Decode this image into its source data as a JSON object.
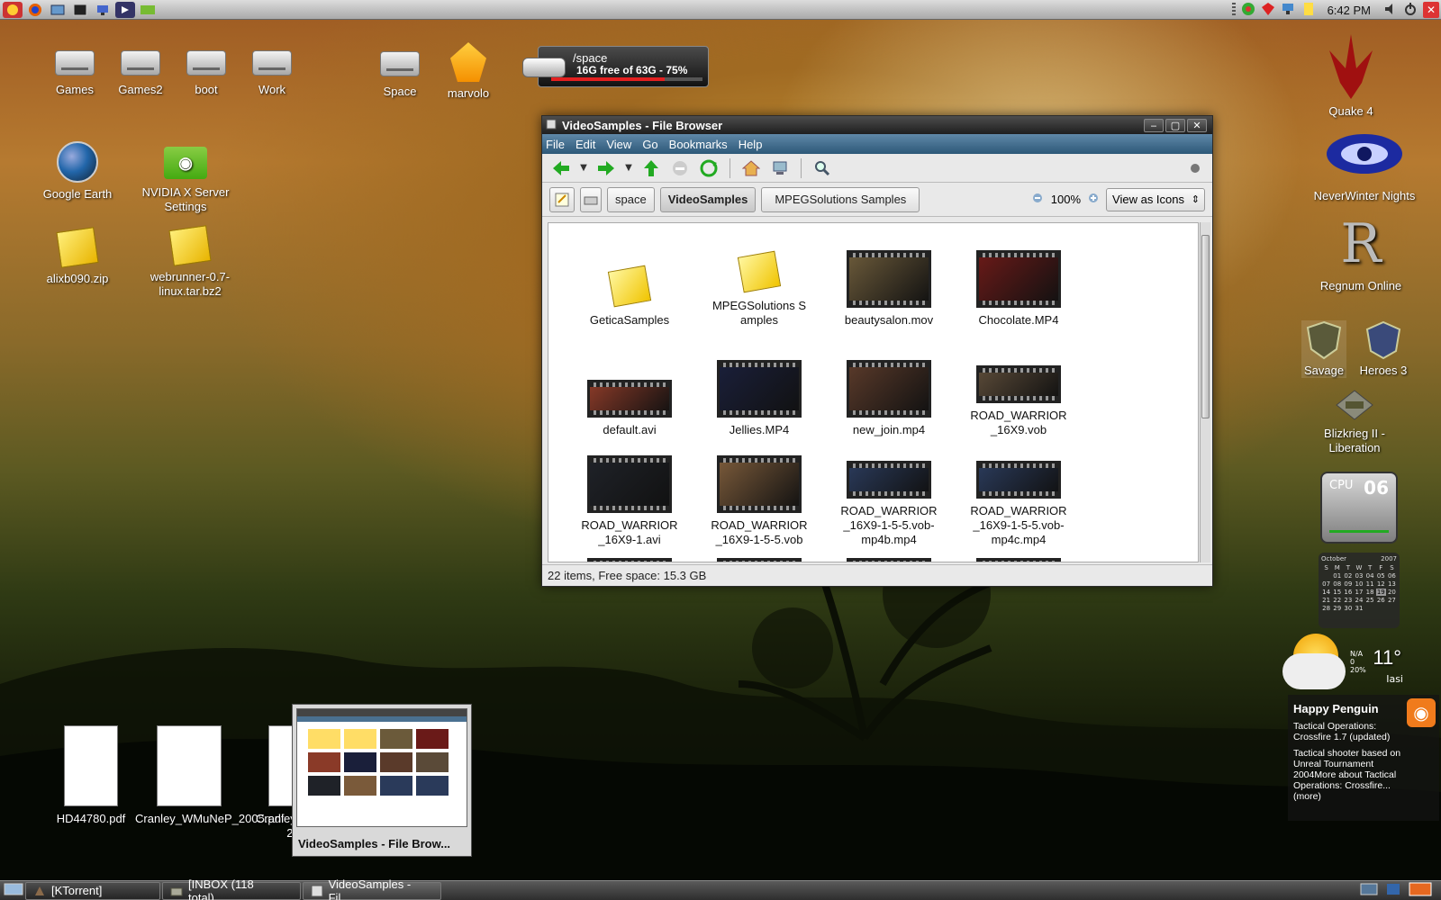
{
  "top_panel": {
    "launchers": [
      "menu-icon",
      "firefox-icon",
      "file-manager-icon",
      "terminal-icon",
      "display-icon",
      "screenshot-icon",
      "nvidia-icon"
    ],
    "clock": "6:42 PM",
    "close_label": "✕"
  },
  "desktop_icons_left": [
    {
      "label": "Games"
    },
    {
      "label": "Games2"
    },
    {
      "label": "boot"
    },
    {
      "label": "Work"
    },
    {
      "label": "Space"
    },
    {
      "label": "marvolo"
    },
    {
      "label": "Google Earth"
    },
    {
      "label": "NVIDIA X Server Settings"
    },
    {
      "label": "alixb090.zip"
    },
    {
      "label": "webrunner-0.7-linux.tar.bz2"
    }
  ],
  "disk_widget": {
    "path": "/space",
    "free_text": "16G free of 63G - 75%",
    "used_fraction": 0.75
  },
  "window": {
    "title": "VideoSamples - File Browser",
    "buttons": {
      "minimize": "‒",
      "maximize": "▢",
      "close": "✕"
    },
    "menu": [
      "File",
      "Edit",
      "View",
      "Go",
      "Bookmarks",
      "Help"
    ],
    "path_buttons": [
      "space",
      "VideoSamples",
      "MPEGSolutions Samples"
    ],
    "zoom_label": "100%",
    "view_mode": "View as Icons",
    "status": "22 items, Free space: 15.3 GB",
    "files": [
      {
        "name": "GeticaSamples",
        "kind": "folder"
      },
      {
        "name": "MPEGSolutions Samples",
        "kind": "folder"
      },
      {
        "name": "beautysalon.mov",
        "kind": "video",
        "color": "#6b5a3a"
      },
      {
        "name": "Chocolate.MP4",
        "kind": "video",
        "color": "#6a1a18"
      },
      {
        "name": "default.avi",
        "kind": "video-wide",
        "color": "#8a3a28"
      },
      {
        "name": "Jellies.MP4",
        "kind": "video",
        "color": "#1a1f3a"
      },
      {
        "name": "new_join.mp4",
        "kind": "video",
        "color": "#5a3a2a"
      },
      {
        "name": "ROAD_WARRIOR_16X9.vob",
        "kind": "video-wide",
        "color": "#5a4a38"
      },
      {
        "name": "ROAD_WARRIOR_16X9-1.avi",
        "kind": "video",
        "color": "#1f2228"
      },
      {
        "name": "ROAD_WARRIOR_16X9-1-5-5.vob",
        "kind": "video",
        "color": "#7a5a3a"
      },
      {
        "name": "ROAD_WARRIOR_16X9-1-5-5.vob-mp4b.mp4",
        "kind": "video-wide",
        "color": "#2a3a5a"
      },
      {
        "name": "ROAD_WARRIOR_16X9-1-5-5.vob-mp4c.mp4",
        "kind": "video-wide",
        "color": "#2a3a5a"
      },
      {
        "name": "",
        "kind": "video-cut",
        "color": "#4a3a2a"
      },
      {
        "name": "",
        "kind": "video-cut",
        "color": "#3a4a5a"
      },
      {
        "name": "",
        "kind": "video-cut",
        "color": "#2a3a5a"
      },
      {
        "name": "",
        "kind": "video-cut",
        "color": "#4a5a6a"
      }
    ]
  },
  "right_icons": [
    {
      "label": "Quake 4"
    },
    {
      "label": "NeverWinter Nights"
    },
    {
      "label": "Regnum Online"
    },
    {
      "label": "Savage"
    },
    {
      "label": "Heroes 3"
    },
    {
      "label": "Blizkrieg II - Liberation"
    }
  ],
  "cpu_widget": {
    "label": "CPU",
    "value": "06"
  },
  "calendar": {
    "month": "October",
    "year": "2007",
    "days_header": [
      "S",
      "M",
      "T",
      "W",
      "T",
      "F",
      "S"
    ],
    "days": [
      "",
      "01",
      "02",
      "03",
      "04",
      "05",
      "06",
      "07",
      "08",
      "09",
      "10",
      "11",
      "12",
      "13",
      "14",
      "15",
      "16",
      "17",
      "18",
      "19",
      "20",
      "21",
      "22",
      "23",
      "24",
      "25",
      "26",
      "27",
      "28",
      "29",
      "30",
      "31",
      "",
      "",
      ""
    ]
  },
  "weather": {
    "temp": "11°",
    "city": "Iasi",
    "na_line1": "N/A",
    "na_line2": "0",
    "na_line3": "20%"
  },
  "rss": {
    "title": "Happy Penguin",
    "item1": "Tactical Operations: Crossfire 1.7 (updated)",
    "item2": "Tactical shooter based on Unreal Tournament 2004More about Tactical Operations: Crossfire... (more)"
  },
  "pdfs": [
    {
      "label": "HD44780.pdf"
    },
    {
      "label": "Cranley_WMuNeP_2005.pdf"
    },
    {
      "label": "Cranley_"
    },
    {
      "label": "200"
    }
  ],
  "preview_caption": "VideoSamples - File Brow...",
  "taskbar": [
    {
      "label": "[KTorrent]"
    },
    {
      "label": "[INBOX (118 total)..."
    },
    {
      "label": "VideoSamples - Fil..."
    }
  ]
}
